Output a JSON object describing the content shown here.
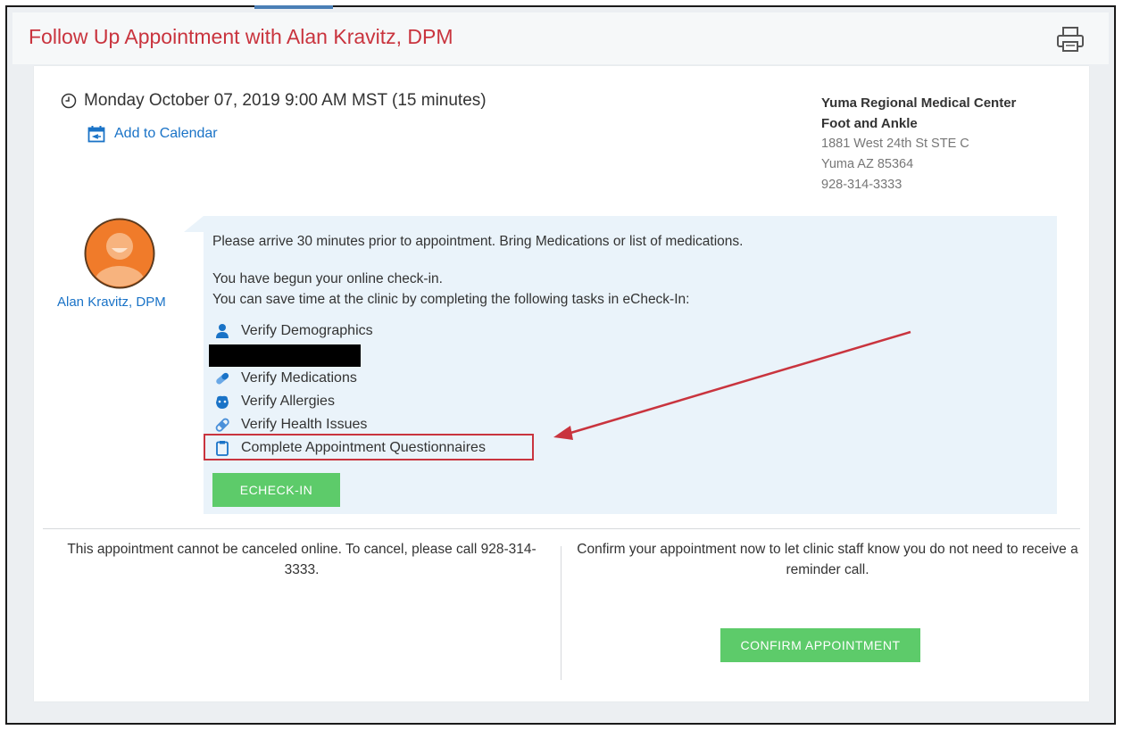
{
  "header": {
    "title": "Follow Up Appointment with Alan Kravitz, DPM",
    "print_icon": "printer-icon"
  },
  "appointment": {
    "datetime": "Monday October 07, 2019 9:00 AM MST (15 minutes)",
    "datetime_icon": "clock-icon",
    "add_to_calendar": "Add to Calendar",
    "calendar_icon": "calendar-add-icon"
  },
  "location": {
    "name": "Yuma Regional Medical Center",
    "department": "Foot and Ankle",
    "address_line": "1881 West 24th St STE C",
    "city_line": "Yuma AZ 85364",
    "phone": "928-314-3333"
  },
  "provider": {
    "name": "Alan Kravitz, DPM",
    "avatar_icon": "avatar-icon"
  },
  "instructions": {
    "arrival_note": "Please arrive 30 minutes prior to appointment. Bring Medications or list of medications.",
    "checkin_status": "You have begun your online check-in.",
    "checkin_prompt": "You can save time at the clinic by completing the following tasks in eCheck-In:",
    "tasks": [
      {
        "label": "Verify Demographics",
        "icon": "person-icon",
        "color": "#1a73c7"
      },
      {
        "label": "Verify Medications",
        "icon": "pill-icon",
        "color": "#4a90d9"
      },
      {
        "label": "Verify Allergies",
        "icon": "allergy-icon",
        "color": "#1a73c7"
      },
      {
        "label": "Verify Health Issues",
        "icon": "bandage-icon",
        "color": "#4a90d9"
      },
      {
        "label": "Complete Appointment Questionnaires",
        "icon": "clipboard-icon",
        "color": "#1a73c7"
      }
    ],
    "echeckin_button": "ECHECK-IN"
  },
  "cancel": {
    "text": "This appointment cannot be canceled online. To cancel, please call 928-314-3333."
  },
  "confirm": {
    "text": "Confirm your appointment now to let clinic staff know you do not need to receive a reminder call.",
    "button": "CONFIRM APPOINTMENT"
  },
  "colors": {
    "title": "#c9343e",
    "link": "#1a73c7",
    "button": "#5dcb6a",
    "annotation": "#c9343e",
    "bubble": "#eaf3fa"
  }
}
